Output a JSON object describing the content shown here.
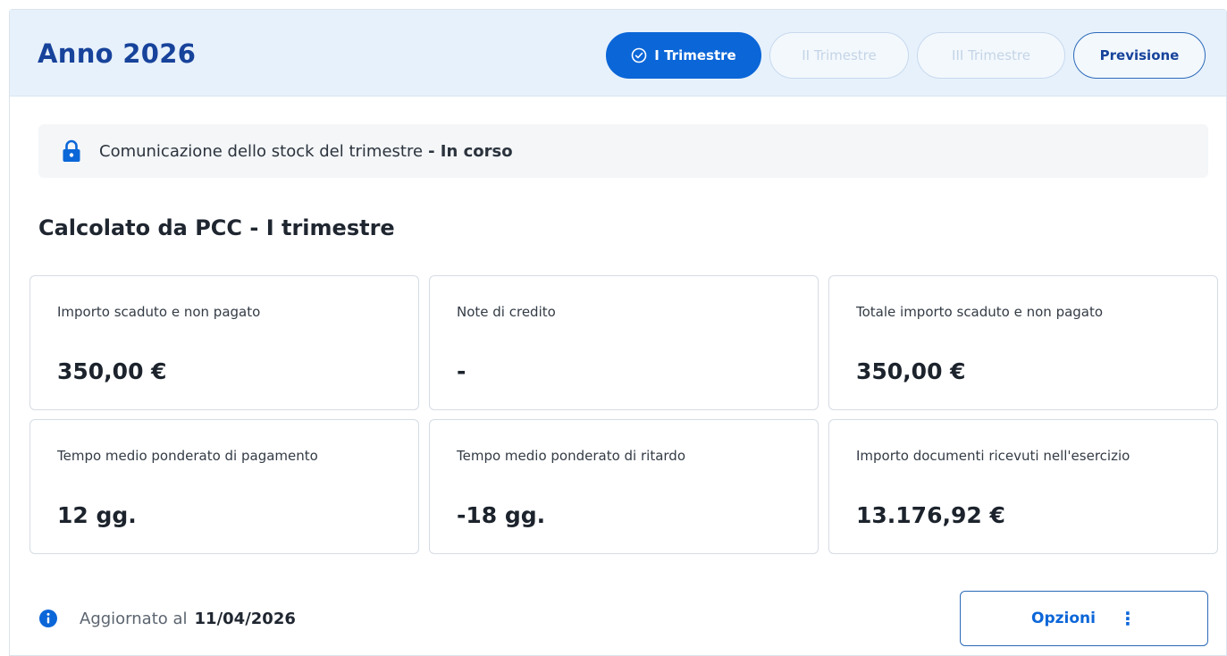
{
  "header": {
    "title": "Anno 2026",
    "tabs": [
      {
        "label": "I Trimestre",
        "state": "active",
        "icon": "check-circle-icon"
      },
      {
        "label": "II Trimestre",
        "state": "disabled"
      },
      {
        "label": "III Trimestre",
        "state": "disabled"
      },
      {
        "label": "Previsione",
        "state": "enabled"
      }
    ]
  },
  "status": {
    "icon": "lock-icon",
    "text": "Comunicazione dello stock del trimestre",
    "state": "- In corso"
  },
  "section": {
    "title": "Calcolato da PCC - I trimestre"
  },
  "metrics": [
    {
      "label": "Importo scaduto e non pagato",
      "value": "350,00 €"
    },
    {
      "label": "Note di credito",
      "value": "-"
    },
    {
      "label": "Totale importo scaduto e non pagato",
      "value": "350,00 €"
    },
    {
      "label": "Tempo medio ponderato di pagamento",
      "value": "12 gg."
    },
    {
      "label": "Tempo medio ponderato di ritardo",
      "value": "-18 gg."
    },
    {
      "label": "Importo documenti ricevuti nell'esercizio",
      "value": "13.176,92 €"
    }
  ],
  "footer": {
    "icon": "info-icon",
    "updated_label": "Aggiornato al",
    "updated_date": "11/04/2026",
    "options_label": "Opzioni",
    "options_icon": "kebab-menu-icon"
  },
  "colors": {
    "primary": "#0b66d8",
    "title": "#17439b",
    "header_bg": "#e7f1fb"
  }
}
